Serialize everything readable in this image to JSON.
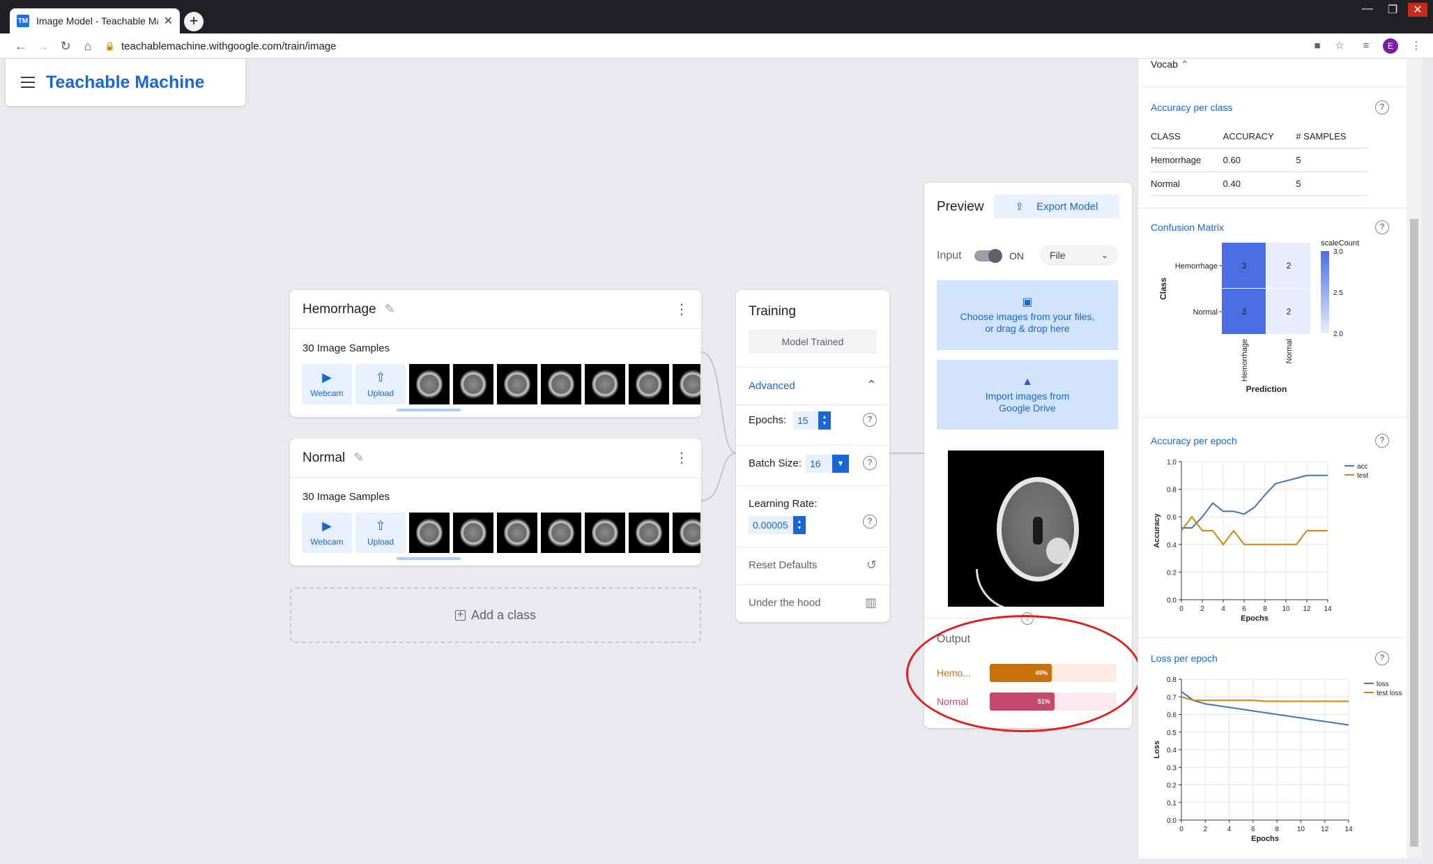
{
  "browser": {
    "tab_title": "Image Model - Teachable Machi",
    "favicon": "TM",
    "url": "teachablemachine.withgoogle.com/train/image",
    "avatar_letter": "E"
  },
  "app": {
    "brand": "Teachable Machine"
  },
  "classes": [
    {
      "name": "Hemorrhage",
      "samples": "30 Image Samples",
      "webcam": "Webcam",
      "upload": "Upload"
    },
    {
      "name": "Normal",
      "samples": "30 Image Samples",
      "webcam": "Webcam",
      "upload": "Upload"
    }
  ],
  "add_class": "Add a class",
  "training": {
    "title": "Training",
    "status_button": "Model Trained",
    "advanced": "Advanced",
    "epochs_label": "Epochs:",
    "epochs_value": "15",
    "batch_label": "Batch Size:",
    "batch_value": "16",
    "lr_label": "Learning Rate:",
    "lr_value": "0.00005",
    "reset": "Reset Defaults",
    "under_hood": "Under the hood"
  },
  "preview": {
    "title": "Preview",
    "export": "Export Model",
    "input_label": "Input",
    "toggle_state": "ON",
    "source": "File",
    "choose_line1": "Choose images from your files,",
    "choose_line2": "or drag & drop here",
    "drive_line1": "Import images from",
    "drive_line2": "Google Drive",
    "output_title": "Output",
    "outputs": [
      {
        "label": "Hemo...",
        "value": 49,
        "text": "49%",
        "color": "#c8700a",
        "bg": "#fcebe0"
      },
      {
        "label": "Normal",
        "value": 51,
        "text": "51%",
        "color": "#c5496a",
        "bg": "#fce8ee"
      }
    ]
  },
  "panel": {
    "vocab": "Vocab",
    "acc_class_title": "Accuracy per class",
    "acc_table": {
      "headers": [
        "CLASS",
        "ACCURACY",
        "# SAMPLES"
      ],
      "rows": [
        [
          "Hemorrhage",
          "0.60",
          "5"
        ],
        [
          "Normal",
          "0.40",
          "5"
        ]
      ]
    },
    "confusion_title": "Confusion Matrix",
    "acc_epoch_title": "Accuracy per epoch",
    "loss_epoch_title": "Loss per epoch"
  },
  "chart_data": [
    {
      "type": "heatmap",
      "title": "Confusion Matrix",
      "rows": [
        "Hemorrhage",
        "Normal"
      ],
      "cols": [
        "Hemorrhage",
        "Normal"
      ],
      "values": [
        [
          3,
          2
        ],
        [
          3,
          2
        ]
      ],
      "ylabel": "Class",
      "xlabel": "Prediction",
      "legend_title": "scaleCount",
      "scale_ticks": [
        "3.0",
        "2.5",
        "2.0"
      ],
      "colors": {
        "high": "#4a6fe3",
        "low": "#e8ecfc"
      }
    },
    {
      "type": "line",
      "title": "Accuracy per epoch",
      "xlabel": "Epochs",
      "ylabel": "Accuracy",
      "x": [
        0,
        1,
        2,
        3,
        4,
        5,
        6,
        7,
        8,
        9,
        10,
        11,
        12,
        13,
        14
      ],
      "xticks": [
        0,
        2,
        4,
        6,
        8,
        10,
        12,
        14
      ],
      "yticks": [
        "0.0",
        "0.2",
        "0.4",
        "0.6",
        "0.8",
        "1.0"
      ],
      "ylim": [
        0,
        1
      ],
      "legend": "top-right",
      "series": [
        {
          "name": "acc",
          "color": "#4472c4",
          "values": [
            0.52,
            0.52,
            0.6,
            0.7,
            0.64,
            0.64,
            0.62,
            0.67,
            0.76,
            0.84,
            0.86,
            0.88,
            0.9,
            0.9,
            0.9
          ]
        },
        {
          "name": "test",
          "color": "#d4820a",
          "values": [
            0.5,
            0.6,
            0.5,
            0.5,
            0.4,
            0.5,
            0.4,
            0.4,
            0.4,
            0.4,
            0.4,
            0.4,
            0.5,
            0.5,
            0.5
          ]
        }
      ]
    },
    {
      "type": "line",
      "title": "Loss per epoch",
      "xlabel": "Epochs",
      "ylabel": "Loss",
      "x": [
        0,
        1,
        2,
        3,
        4,
        5,
        6,
        7,
        8,
        9,
        10,
        11,
        12,
        13,
        14
      ],
      "xticks": [
        0,
        2,
        4,
        6,
        8,
        10,
        12,
        14
      ],
      "yticks": [
        "0.0",
        "0.1",
        "0.2",
        "0.3",
        "0.4",
        "0.5",
        "0.6",
        "0.7",
        "0.8"
      ],
      "ylim": [
        0,
        0.8
      ],
      "legend": "top-right",
      "series": [
        {
          "name": "loss",
          "color": "#4472c4",
          "values": [
            0.73,
            0.68,
            0.66,
            0.65,
            0.64,
            0.63,
            0.62,
            0.61,
            0.6,
            0.59,
            0.58,
            0.57,
            0.56,
            0.55,
            0.54
          ]
        },
        {
          "name": "test loss",
          "color": "#d4820a",
          "values": [
            0.7,
            0.68,
            0.68,
            0.68,
            0.68,
            0.68,
            0.68,
            0.675,
            0.675,
            0.675,
            0.675,
            0.675,
            0.675,
            0.675,
            0.675
          ]
        }
      ]
    }
  ]
}
